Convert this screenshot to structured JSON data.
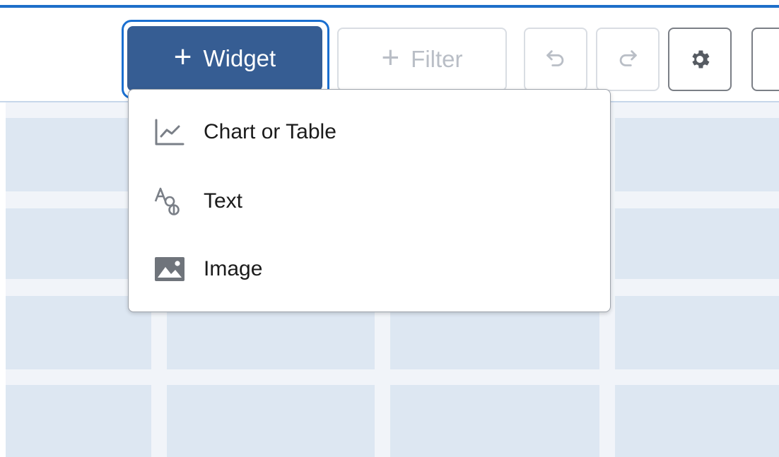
{
  "toolbar": {
    "widget_button": {
      "plus": "+",
      "label": "Widget"
    },
    "filter_button": {
      "plus": "+",
      "label": "Filter"
    },
    "icons": {
      "undo": "undo-icon",
      "redo": "redo-icon",
      "settings": "gear-icon"
    }
  },
  "widget_menu": {
    "items": [
      {
        "label": "Chart or Table",
        "icon": "line-chart-icon"
      },
      {
        "label": "Text",
        "icon": "text-format-icon"
      },
      {
        "label": "Image",
        "icon": "image-icon"
      }
    ]
  },
  "colors": {
    "accent_bar": "#1f6fc9",
    "primary_button": "#365d93",
    "focus_ring": "#1a6fd0",
    "disabled_text": "#b9bec6",
    "grid_cell": "#dde7f2",
    "canvas_bg": "#f1f4f9"
  }
}
